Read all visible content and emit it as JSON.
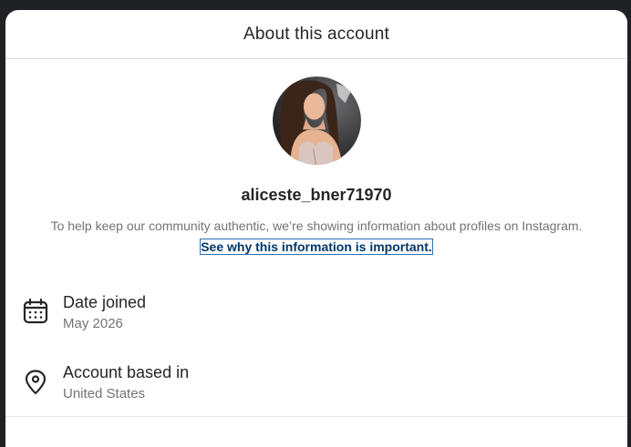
{
  "header": {
    "title": "About this account"
  },
  "profile": {
    "avatar": "profile-photo",
    "username": "aliceste_bner71970"
  },
  "explanation": {
    "text": "To help keep our community authentic, we’re showing information about profiles on Instagram.",
    "link_label": "See why this information is important."
  },
  "details": [
    {
      "icon": "calendar-icon",
      "label": "Date joined",
      "value": "May 2026"
    },
    {
      "icon": "location-pin-icon",
      "label": "Account based in",
      "value": "United States"
    }
  ],
  "colors": {
    "text_primary": "#262626",
    "text_secondary": "#737373",
    "link": "#00376b",
    "divider": "#dbdbdb"
  }
}
